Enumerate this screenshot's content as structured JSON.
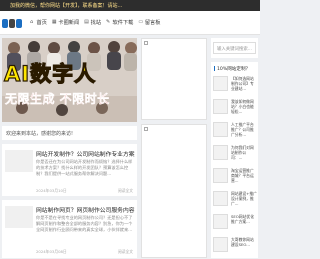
{
  "topbar": {
    "notice": "加我的微信，帮你网站【开发】，联系备案！请站..."
  },
  "nav": [
    {
      "icon": "home-icon",
      "glyph": "⌂",
      "label": "首页"
    },
    {
      "icon": "grid-icon",
      "glyph": "▦",
      "label": "卡圈新闻"
    },
    {
      "icon": "book-icon",
      "glyph": "▤",
      "label": "找站"
    },
    {
      "icon": "wrench-icon",
      "glyph": "✎",
      "label": "软件下载"
    },
    {
      "icon": "chat-icon",
      "glyph": "▭",
      "label": "留言板"
    }
  ],
  "banner": {
    "headline": "AI数字人",
    "subline": "无限生成 不限时长"
  },
  "notice": "欢迎来到本站，感谢您的来访!",
  "posts": [
    {
      "title": "网站开发制作？公司网站制作专业方案",
      "excerpt": "你是否还在为公司网站开发制作而烦恼？选择什么样的技术方案？找什么样的开发团队？预算该怎么控制？我们提供一站式服务帮你解决问题...",
      "date": "2024年03月10日",
      "more": "阅读全文"
    },
    {
      "title": "网站制作网页？网页制作公司服务内容",
      "excerpt": "你是不是在寻找专业的网页制作公司？还是担心不了解网页制作和整合全部的服务内容？别急，你为一个全网页制作行业顾问带来的真实全球，小伙伴就来...",
      "date": "2024年03月08日",
      "more": "阅读全文"
    }
  ],
  "sidebar": {
    "search_placeholder": "输入关键词搜索...",
    "list_title": "10%网站定制？",
    "items": [
      {
        "text": "【如何选网站制作公司】专业建站..."
      },
      {
        "text": "我该如何做网站？小白也能轻松..."
      },
      {
        "text": "人工推广平台推广？公司推广分析..."
      },
      {
        "text": "为何我们对网站制作公司：..."
      },
      {
        "text": "淘宝运营推广商城？平台运营..."
      },
      {
        "text": "网站建设+推广设计案例，推广..."
      },
      {
        "text": "SEO网站优化推广方案..."
      },
      {
        "text": "大哥教你网站建设SEO..."
      }
    ]
  }
}
